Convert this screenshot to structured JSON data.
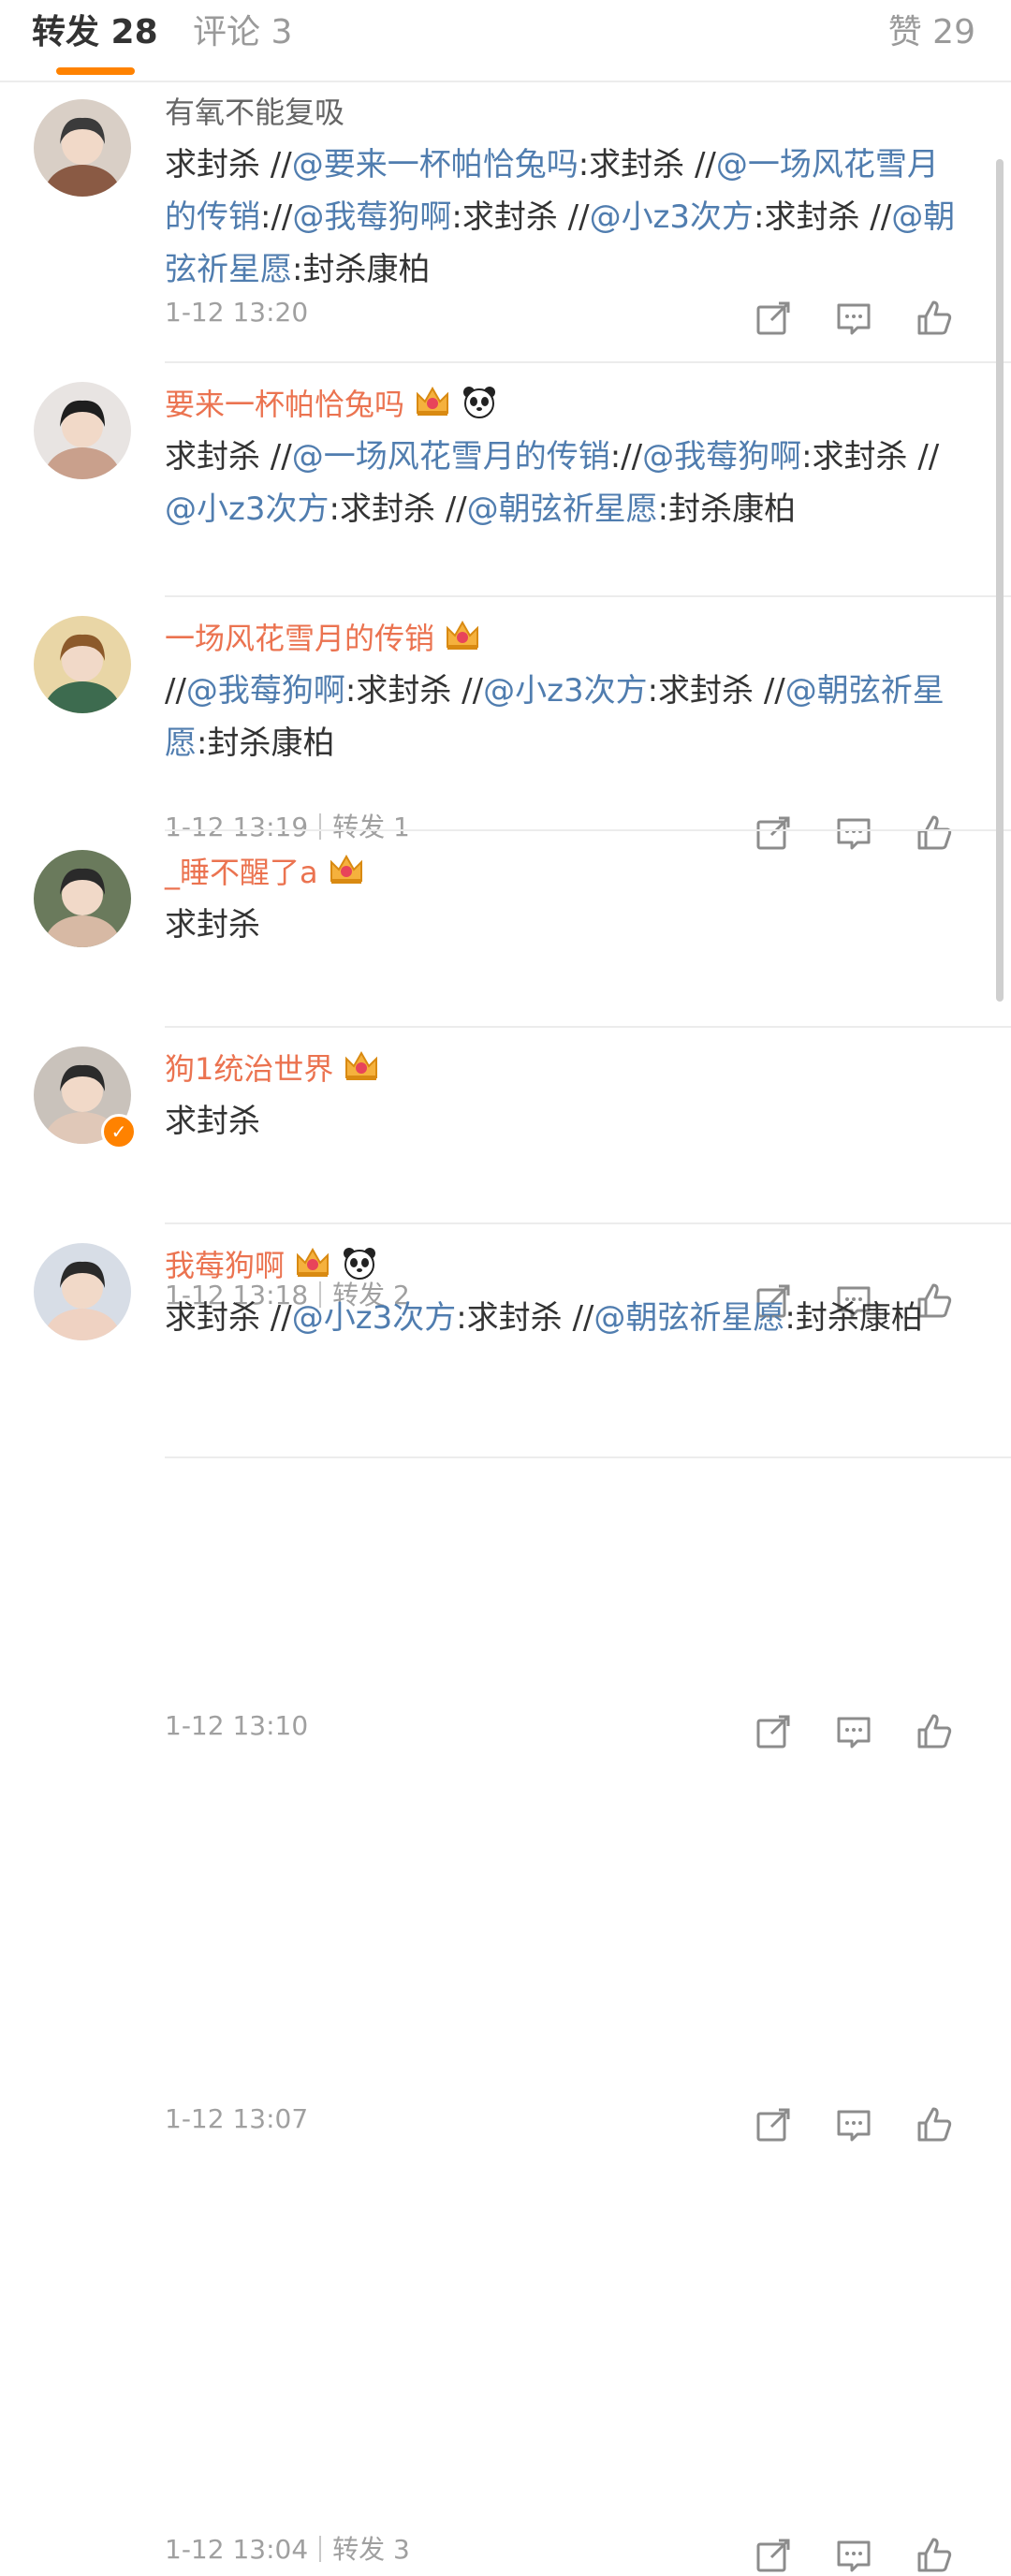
{
  "tabs": {
    "repost": "转发 28",
    "comments": "评论 3",
    "likes": "赞 29"
  },
  "colors": {
    "accent": "#ff8200",
    "mention": "#507daf",
    "username": "#eb7350",
    "meta": "#a0a0a0"
  },
  "posts": [
    {
      "username": "有氧不能复吸",
      "badges": [],
      "segments": [
        {
          "t": "求封杀 //"
        },
        {
          "t": "@要来一杯帕恰兔吗",
          "m": true
        },
        {
          "t": ":求封杀 //"
        },
        {
          "t": "@一场风花雪月的传销",
          "m": true
        },
        {
          "t": "://"
        },
        {
          "t": "@我莓狗啊",
          "m": true
        },
        {
          "t": ":求封杀 //"
        },
        {
          "t": "@小z3次方",
          "m": true
        },
        {
          "t": ":求封杀 //"
        },
        {
          "t": "@朝弦祈星愿",
          "m": true
        },
        {
          "t": ":封杀康柏"
        }
      ],
      "time": "1-12 13:20",
      "repost_info": ""
    },
    {
      "username": "要来一杯帕恰兔吗",
      "badges": [
        "crown-badge-icon",
        "panda-icon"
      ],
      "segments": [
        {
          "t": "求封杀 //"
        },
        {
          "t": "@一场风花雪月的传销",
          "m": true
        },
        {
          "t": "://"
        },
        {
          "t": "@我莓狗啊",
          "m": true
        },
        {
          "t": ":求封杀 //"
        },
        {
          "t": "@小z3次方",
          "m": true
        },
        {
          "t": ":求封杀 //"
        },
        {
          "t": "@朝弦祈星愿",
          "m": true
        },
        {
          "t": ":封杀康柏"
        }
      ],
      "time": "1-12 13:19",
      "repost_info": "转发 1"
    },
    {
      "username": "一场风花雪月的传销",
      "badges": [
        "crown-badge-icon"
      ],
      "segments": [
        {
          "t": "//"
        },
        {
          "t": "@我莓狗啊",
          "m": true
        },
        {
          "t": ":求封杀 //"
        },
        {
          "t": "@小z3次方",
          "m": true
        },
        {
          "t": ":求封杀 //"
        },
        {
          "t": "@朝弦祈星愿",
          "m": true
        },
        {
          "t": ":封杀康柏"
        }
      ],
      "time": "1-12 13:18",
      "repost_info": "转发 2"
    },
    {
      "username": "_睡不醒了a",
      "badges": [
        "crown-badge-icon"
      ],
      "segments": [
        {
          "t": "求封杀"
        }
      ],
      "time": "1-12 13:10",
      "repost_info": ""
    },
    {
      "username": "狗1统治世界",
      "badges": [
        "crown-badge-icon"
      ],
      "segments": [
        {
          "t": "求封杀"
        }
      ],
      "time": "1-12 13:07",
      "repost_info": "",
      "verified": true
    },
    {
      "username": "我莓狗啊",
      "badges": [
        "crown-badge-icon",
        "panda-icon"
      ],
      "segments": [
        {
          "t": "求封杀 //"
        },
        {
          "t": "@小z3次方",
          "m": true
        },
        {
          "t": ":求封杀 //"
        },
        {
          "t": "@朝弦祈星愿",
          "m": true
        },
        {
          "t": ":封杀康柏"
        }
      ],
      "time": "1-12 13:04",
      "repost_info": "转发 3"
    }
  ]
}
